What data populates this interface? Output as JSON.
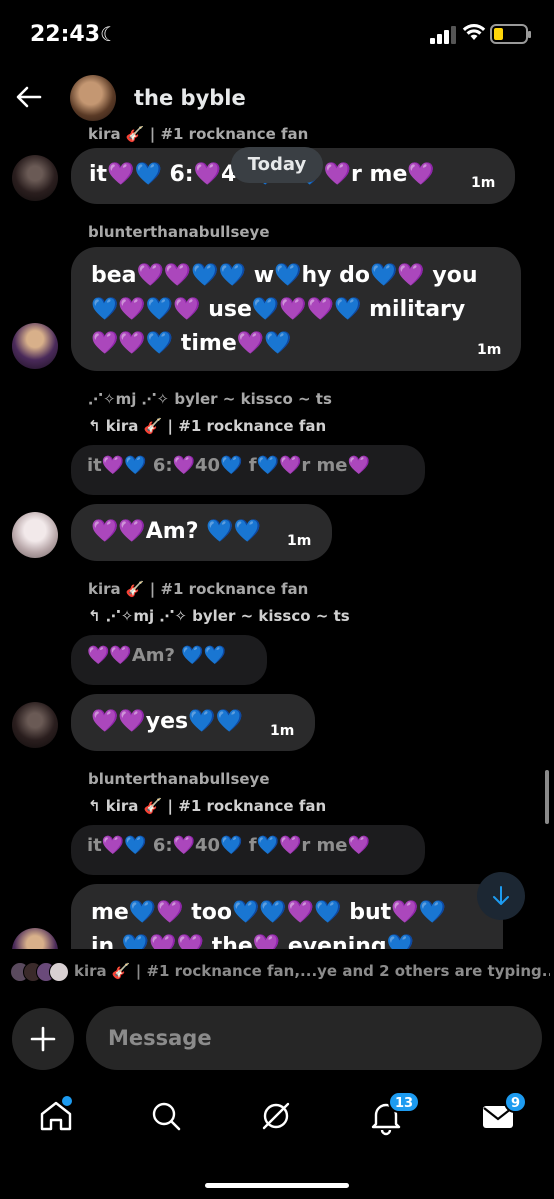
{
  "status_bar": {
    "time": "22:43"
  },
  "header": {
    "title": "the byble"
  },
  "date_divider": "Today",
  "messages": [
    {
      "sender": "kira 🎸 | #1 rocknance fan",
      "text": "it💜💙 6:💜40💙 f💙💜r me💜",
      "time": "1m"
    },
    {
      "sender": "blunterthanabullseye",
      "lines": [
        "bea💜💜💙💙 w💙hy do💙💜 you",
        "💙💜💙💜 use💙💜💜💙 military",
        "💜💜💙 time💜💙"
      ],
      "time": "1m"
    },
    {
      "sender": "⋰✧mj ⋰✧ byler ~ kissco ~ ts",
      "reply_to": "kira 🎸 | #1 rocknance fan",
      "quoted": "it💜💙 6:💜40💙 f💙💜r me💜",
      "text": "💜💜Am? 💙💙",
      "time": "1m"
    },
    {
      "sender": "kira 🎸 | #1 rocknance fan",
      "reply_to": "⋰✧mj ⋰✧ byler ~ kissco ~ ts",
      "quoted": "💜💜Am? 💙💙",
      "text": "💜💜yes💙💙",
      "time": "1m"
    },
    {
      "sender": "blunterthanabullseye",
      "reply_to": "kira 🎸 | #1 rocknance fan",
      "quoted": "it💜💙 6:💜40💙 f💙💜r me💜",
      "lines": [
        "me💙💜 too💙💙💜💙 but💜💙",
        "in 💙💜💜 the💜 evening💙"
      ]
    }
  ],
  "typing_indicator": "kira 🎸 | #1 rocknance fan,...ye and 2 others are typing...",
  "composer": {
    "placeholder": "Message"
  },
  "nav": {
    "notifications_badge": "13",
    "messages_badge": "9"
  },
  "colors": {
    "accent": "#1d9bf0",
    "bubble": "#2a2a2b",
    "background": "#000000"
  },
  "icons": [
    "back-arrow-icon",
    "plus-icon",
    "home-icon",
    "search-icon",
    "grok-icon",
    "bell-icon",
    "mail-icon",
    "arrow-down-icon"
  ]
}
